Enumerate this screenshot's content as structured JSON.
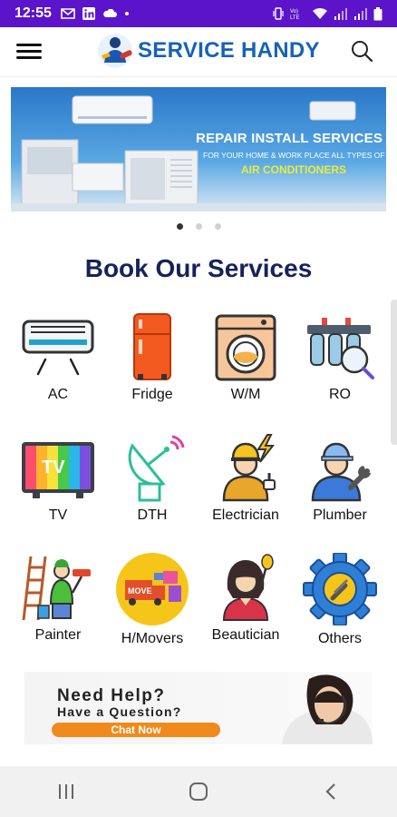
{
  "status_bar": {
    "time": "12:55",
    "left_icons": [
      "gmail-icon",
      "linkedin-icon",
      "cloud-icon",
      "dot-icon"
    ],
    "right_icons": [
      "vibrate-icon",
      "volte-icon",
      "wifi-icon",
      "signal-icon",
      "signal-icon",
      "battery-icon"
    ]
  },
  "app_bar": {
    "brand_title": "SERVICE HANDY",
    "menu_icon": "hamburger-icon",
    "search_icon": "search-icon"
  },
  "banner": {
    "title": "REPAIR INSTALL SERVICES",
    "subtitle": "FOR YOUR HOME & WORK PLACE ALL TYPES OF",
    "highlight": "AIR CONDITIONERS",
    "slides": 3,
    "active_slide": 1
  },
  "services": {
    "heading": "Book Our Services",
    "items": [
      {
        "label": "AC",
        "icon": "air-conditioner-icon"
      },
      {
        "label": "Fridge",
        "icon": "fridge-icon"
      },
      {
        "label": "W/M",
        "icon": "washing-machine-icon"
      },
      {
        "label": "RO",
        "icon": "water-purifier-icon"
      },
      {
        "label": "TV",
        "icon": "tv-icon"
      },
      {
        "label": "DTH",
        "icon": "satellite-dish-icon"
      },
      {
        "label": "Electrician",
        "icon": "electrician-icon"
      },
      {
        "label": "Plumber",
        "icon": "plumber-icon"
      },
      {
        "label": "Painter",
        "icon": "painter-icon"
      },
      {
        "label": "H/Movers",
        "icon": "movers-icon"
      },
      {
        "label": "Beautician",
        "icon": "beautician-icon"
      },
      {
        "label": "Others",
        "icon": "gear-icon"
      }
    ]
  },
  "help_card": {
    "line1": "Need Help?",
    "line2": "Have a Question?",
    "button": "Chat Now"
  },
  "nav_bar": {
    "recents_icon": "recents-icon",
    "home_icon": "home-icon",
    "back_icon": "back-icon"
  },
  "colors": {
    "status_bar": "#5b14c9",
    "brand": "#1762b8",
    "heading": "#16225a",
    "chat_button": "#f08a1c"
  }
}
